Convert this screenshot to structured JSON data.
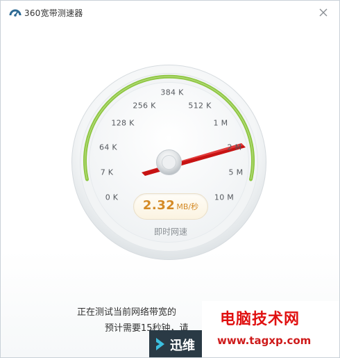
{
  "window": {
    "title": "360宽带测速器",
    "icons": {
      "app": "speedometer-app-icon",
      "close": "close-icon"
    }
  },
  "gauge": {
    "tick_labels": [
      "0 K",
      "7 K",
      "64 K",
      "128 K",
      "256 K",
      "384 K",
      "512 K",
      "1 M",
      "2 M",
      "5 M",
      "10 M"
    ],
    "needle_label": "2 M",
    "colors": {
      "needle": "#c71313",
      "arc": "#8cc63f",
      "speed_text": "#d48a25"
    }
  },
  "speed": {
    "value": "2.32",
    "unit": "MB/秒",
    "caption": "即时网速"
  },
  "status": {
    "line1": "正在测试当前网络带宽的",
    "line2": "预计需要15秒钟，请"
  },
  "watermark": {
    "site_name": "电脑技术网",
    "site_url": "www.tagxp.com",
    "overlay_text": "迅维"
  }
}
